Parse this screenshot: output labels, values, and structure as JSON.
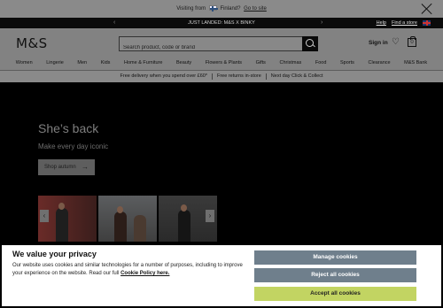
{
  "visit_bar": {
    "prefix": "Visiting from",
    "country": "Finland?",
    "go_link": "Go to site"
  },
  "promo_bar": {
    "text": "JUST LANDED: M&S X BINKY",
    "help": "Help",
    "find_store": "Find a store"
  },
  "header": {
    "logo": "M&S",
    "search_placeholder": "Search product, code or brand",
    "sign_in": "Sign in",
    "bag_count": "0"
  },
  "nav": {
    "items": [
      "Women",
      "Lingerie",
      "Men",
      "Kids",
      "Home & Furniture",
      "Beauty",
      "Flowers & Plants",
      "Gifts",
      "Christmas",
      "Food",
      "Sports",
      "Clearance",
      "M&S Bank"
    ]
  },
  "delivery": {
    "items": [
      "Free delivery when you spend over £60*",
      "Free returns in-store",
      "Next day Click & Collect"
    ]
  },
  "hero": {
    "title": "She’s back",
    "subtitle": "Make every day iconic",
    "cta": "Shop autumn"
  },
  "cookie": {
    "title": "We value your privacy",
    "text": "Our website uses cookies and similar technologies for a number of purposes, including to improve your experience on the website. Read our full",
    "link": "Cookie Policy here.",
    "manage": "Manage cookies",
    "reject": "Reject all cookies",
    "accept": "Accept all cookies"
  },
  "colors": {
    "accept_button": "#c2d462",
    "secondary_button": "#6f7f8c",
    "overlay": "#7e7e7e"
  }
}
